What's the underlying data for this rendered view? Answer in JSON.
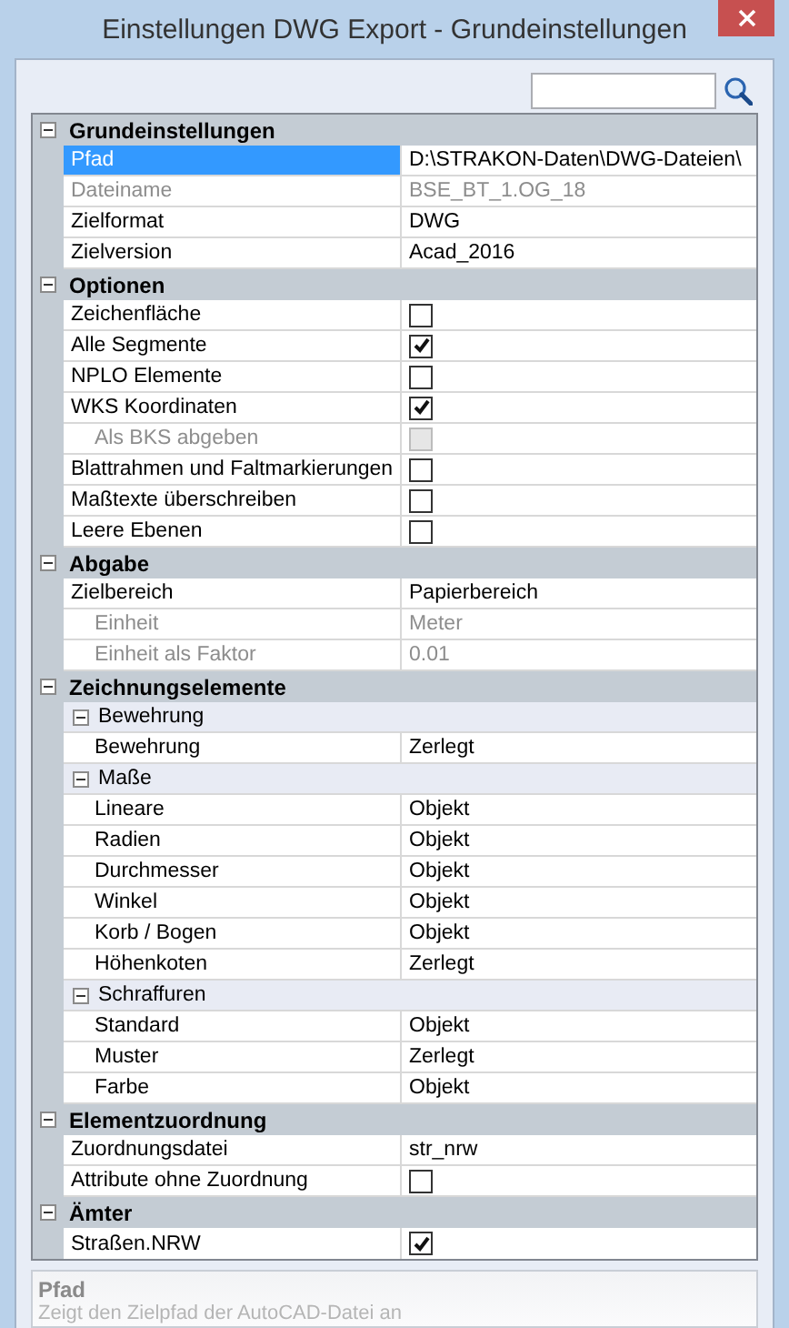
{
  "window": {
    "title": "Einstellungen DWG Export - Grundeinstellungen"
  },
  "categories": [
    {
      "title": "Grundeinstellungen",
      "expanded": true,
      "rows": [
        {
          "kind": "text",
          "label": "Pfad",
          "value": "D:\\STRAKON-Daten\\DWG-Dateien\\",
          "selected": true,
          "disabled": false
        },
        {
          "kind": "text",
          "label": "Dateiname",
          "value": "BSE_BT_1.OG_18",
          "selected": false,
          "disabled": true
        },
        {
          "kind": "text",
          "label": "Zielformat",
          "value": "DWG",
          "selected": false,
          "disabled": false
        },
        {
          "kind": "text",
          "label": "Zielversion",
          "value": "Acad_2016",
          "selected": false,
          "disabled": false
        }
      ]
    },
    {
      "title": "Optionen",
      "expanded": true,
      "rows": [
        {
          "kind": "check",
          "label": "Zeichenfläche",
          "checked": false,
          "selected": false,
          "disabled": false
        },
        {
          "kind": "check",
          "label": "Alle Segmente",
          "checked": true,
          "selected": false,
          "disabled": false
        },
        {
          "kind": "check",
          "label": "NPLO Elemente",
          "checked": false,
          "selected": false,
          "disabled": false
        },
        {
          "kind": "check",
          "label": "WKS Koordinaten",
          "checked": true,
          "selected": false,
          "disabled": false,
          "children": [
            {
              "kind": "check",
              "label": "Als BKS abgeben",
              "checked": false,
              "selected": false,
              "disabled": true
            }
          ]
        },
        {
          "kind": "check",
          "label": "Blattrahmen und Faltmarkierungen",
          "checked": false,
          "selected": false,
          "disabled": false
        },
        {
          "kind": "check",
          "label": "Maßtexte überschreiben",
          "checked": false,
          "selected": false,
          "disabled": false
        },
        {
          "kind": "check",
          "label": "Leere Ebenen",
          "checked": false,
          "selected": false,
          "disabled": false
        }
      ]
    },
    {
      "title": "Abgabe",
      "expanded": true,
      "rows": [
        {
          "kind": "text",
          "label": "Zielbereich",
          "value": "Papierbereich",
          "selected": false,
          "disabled": false,
          "children": [
            {
              "kind": "text",
              "label": "Einheit",
              "value": "Meter",
              "selected": false,
              "disabled": true
            },
            {
              "kind": "text",
              "label": "Einheit als Faktor",
              "value": "0.01",
              "selected": false,
              "disabled": true
            }
          ]
        }
      ]
    },
    {
      "title": "Zeichnungselemente",
      "expanded": true,
      "rows": [
        {
          "kind": "group",
          "label": "Bewehrung",
          "expanded": true,
          "selected": false,
          "children": [
            {
              "kind": "text",
              "label": "Bewehrung",
              "value": "Zerlegt",
              "selected": false,
              "disabled": false
            }
          ]
        },
        {
          "kind": "group",
          "label": "Maße",
          "expanded": true,
          "selected": false,
          "children": [
            {
              "kind": "text",
              "label": "Lineare",
              "value": "Objekt",
              "selected": false,
              "disabled": false
            },
            {
              "kind": "text",
              "label": "Radien",
              "value": "Objekt",
              "selected": false,
              "disabled": false
            },
            {
              "kind": "text",
              "label": "Durchmesser",
              "value": "Objekt",
              "selected": false,
              "disabled": false
            },
            {
              "kind": "text",
              "label": "Winkel",
              "value": "Objekt",
              "selected": false,
              "disabled": false
            },
            {
              "kind": "text",
              "label": "Korb / Bogen",
              "value": "Objekt",
              "selected": false,
              "disabled": false
            },
            {
              "kind": "text",
              "label": "Höhenkoten",
              "value": "Zerlegt",
              "selected": false,
              "disabled": false
            }
          ]
        },
        {
          "kind": "group",
          "label": "Schraffuren",
          "expanded": true,
          "selected": false,
          "children": [
            {
              "kind": "text",
              "label": "Standard",
              "value": "Objekt",
              "selected": false,
              "disabled": false
            },
            {
              "kind": "text",
              "label": "Muster",
              "value": "Zerlegt",
              "selected": false,
              "disabled": false
            },
            {
              "kind": "text",
              "label": "Farbe",
              "value": "Objekt",
              "selected": false,
              "disabled": false
            }
          ]
        }
      ]
    },
    {
      "title": "Elementzuordnung",
      "expanded": true,
      "rows": [
        {
          "kind": "text",
          "label": "Zuordnungsdatei",
          "value": "str_nrw",
          "selected": false,
          "disabled": false
        },
        {
          "kind": "check",
          "label": "Attribute ohne Zuordnung",
          "checked": false,
          "selected": false,
          "disabled": false
        }
      ]
    },
    {
      "title": "Ämter",
      "expanded": true,
      "rows": [
        {
          "kind": "check",
          "label": "Straßen.NRW",
          "checked": true,
          "selected": false,
          "disabled": false
        }
      ]
    }
  ],
  "description": {
    "title": "Pfad",
    "text": "Zeigt den Zielpfad der AutoCAD-Datei an"
  }
}
